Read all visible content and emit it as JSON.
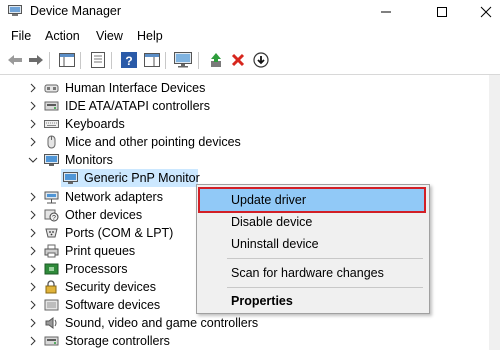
{
  "window": {
    "title": "Device Manager",
    "buttons": {
      "minimize": "—",
      "maximize": "☐",
      "close": "✕"
    }
  },
  "menu": [
    "File",
    "Action",
    "View",
    "Help"
  ],
  "toolbar": {
    "icons": [
      "back-arrow-icon",
      "forward-arrow-icon",
      "properties-icon",
      "show-hide-icon",
      "help-icon",
      "action-pane-icon",
      "monitor-icon",
      "update-driver-icon",
      "uninstall-icon",
      "enable-device-icon"
    ]
  },
  "tree": {
    "items": [
      {
        "label": "Human Interface Devices",
        "expanded": false,
        "icon": "hid-icon"
      },
      {
        "label": "IDE ATA/ATAPI controllers",
        "expanded": false,
        "icon": "ide-icon"
      },
      {
        "label": "Keyboards",
        "expanded": false,
        "icon": "keyboard-icon"
      },
      {
        "label": "Mice and other pointing devices",
        "expanded": false,
        "icon": "mouse-icon"
      },
      {
        "label": "Monitors",
        "expanded": true,
        "icon": "monitor-icon"
      },
      {
        "label": "Generic PnP Monitor",
        "child": true,
        "selected": true,
        "icon": "monitor-icon"
      },
      {
        "label": "Network adapters",
        "expanded": false,
        "icon": "network-icon"
      },
      {
        "label": "Other devices",
        "expanded": false,
        "icon": "other-device-icon"
      },
      {
        "label": "Ports (COM & LPT)",
        "expanded": false,
        "icon": "port-icon"
      },
      {
        "label": "Print queues",
        "expanded": false,
        "icon": "printer-icon"
      },
      {
        "label": "Processors",
        "expanded": false,
        "icon": "processor-icon"
      },
      {
        "label": "Security devices",
        "expanded": false,
        "icon": "security-icon"
      },
      {
        "label": "Software devices",
        "expanded": false,
        "icon": "software-icon"
      },
      {
        "label": "Sound, video and game controllers",
        "expanded": false,
        "icon": "sound-icon"
      },
      {
        "label": "Storage controllers",
        "expanded": false,
        "icon": "storage-icon"
      }
    ]
  },
  "context_menu": {
    "update_driver": "Update driver",
    "disable_device": "Disable device",
    "uninstall_device": "Uninstall device",
    "scan": "Scan for hardware changes",
    "properties": "Properties"
  },
  "colors": {
    "selection": "#cce8ff",
    "menu_hover": "#91c9f7",
    "highlight_border": "#d21f26"
  }
}
